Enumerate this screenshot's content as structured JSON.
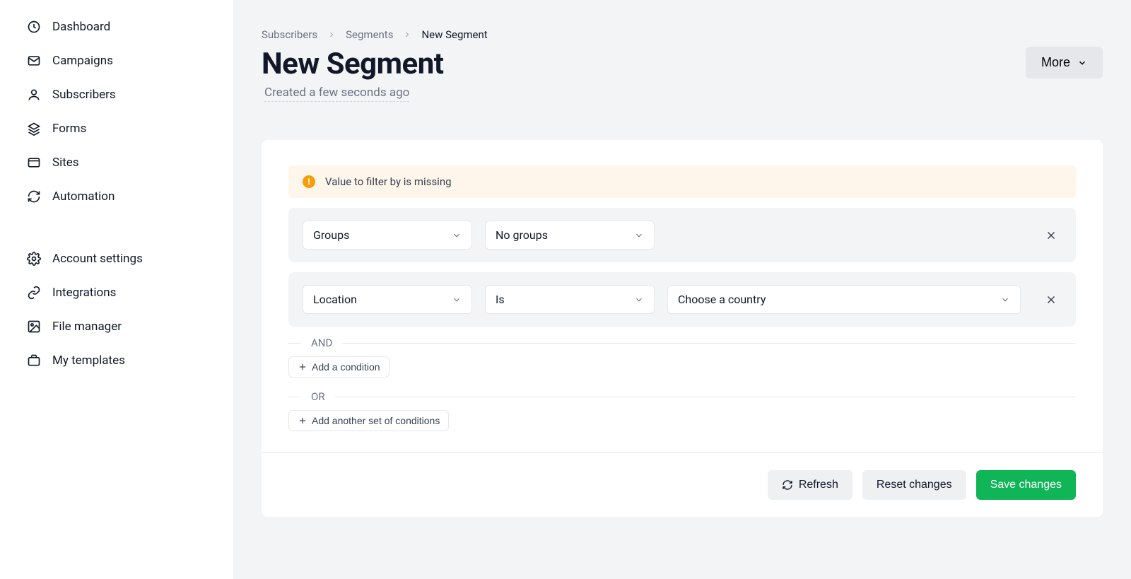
{
  "sidebar": {
    "primary": [
      {
        "label": "Dashboard",
        "icon": "clock"
      },
      {
        "label": "Campaigns",
        "icon": "mail"
      },
      {
        "label": "Subscribers",
        "icon": "user"
      },
      {
        "label": "Forms",
        "icon": "layers"
      },
      {
        "label": "Sites",
        "icon": "window"
      },
      {
        "label": "Automation",
        "icon": "rotate"
      }
    ],
    "secondary": [
      {
        "label": "Account settings",
        "icon": "gear"
      },
      {
        "label": "Integrations",
        "icon": "link"
      },
      {
        "label": "File manager",
        "icon": "image"
      },
      {
        "label": "My templates",
        "icon": "briefcase"
      }
    ]
  },
  "breadcrumb": [
    "Subscribers",
    "Segments",
    "New Segment"
  ],
  "page_title": "New Segment",
  "created_text": "Created a few seconds ago",
  "more_label": "More",
  "alert_text": "Value to filter by is missing",
  "conditions": [
    {
      "field": "Groups",
      "operator": "No groups",
      "value": null
    },
    {
      "field": "Location",
      "operator": "Is",
      "value": "Choose a country"
    }
  ],
  "and_label": "AND",
  "or_label": "OR",
  "add_condition_label": "Add a condition",
  "add_set_label": "Add another set of conditions",
  "buttons": {
    "refresh": "Refresh",
    "reset": "Reset changes",
    "save": "Save changes"
  }
}
